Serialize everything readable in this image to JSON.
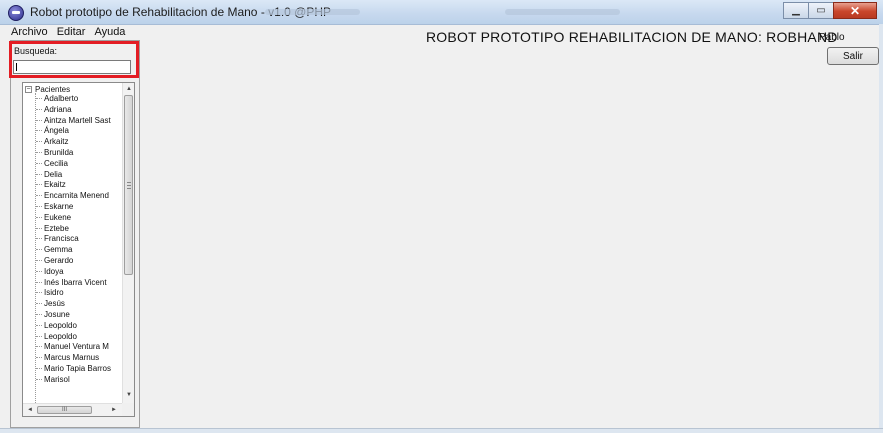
{
  "window": {
    "title": "Robot prototipo de Rehabilitacion de Mano - v1.0 @PHP",
    "minimize": "▁",
    "maximize": "▭",
    "close": "✕"
  },
  "menu": {
    "items": [
      "Archivo",
      "Editar",
      "Ayuda"
    ]
  },
  "header": {
    "app_title": "ROBOT PROTOTIPO REHABILITACION DE MANO: ROBHAND",
    "user": "Pablo",
    "exit_label": "Salir"
  },
  "search": {
    "label": "Busqueda:",
    "value": ""
  },
  "tree": {
    "root_label": "Pacientes",
    "expander": "−",
    "patients": [
      "Adalberto",
      "Adriana",
      "Aintza Martell Sast",
      "Ángela",
      "Arkaitz",
      "Brunilda",
      "Cecilia",
      "Delia",
      "Ekaitz",
      "Encarnita Menend",
      "Eskarne",
      "Eukene",
      "Eztebe",
      "Francisca",
      "Gemma",
      "Gerardo",
      "Idoya",
      "Inés Ibarra Vicent",
      "Isidro",
      "Jesús",
      "Josune",
      "Leopoldo",
      "Leopoldo",
      "Manuel Ventura M",
      "Marcus Marnus",
      "Mario Tapia Barros",
      "Marisol"
    ],
    "scroll_up": "▲",
    "scroll_down": "▼",
    "scroll_left": "◄",
    "scroll_right": "►",
    "hthumb_grip": "III"
  }
}
